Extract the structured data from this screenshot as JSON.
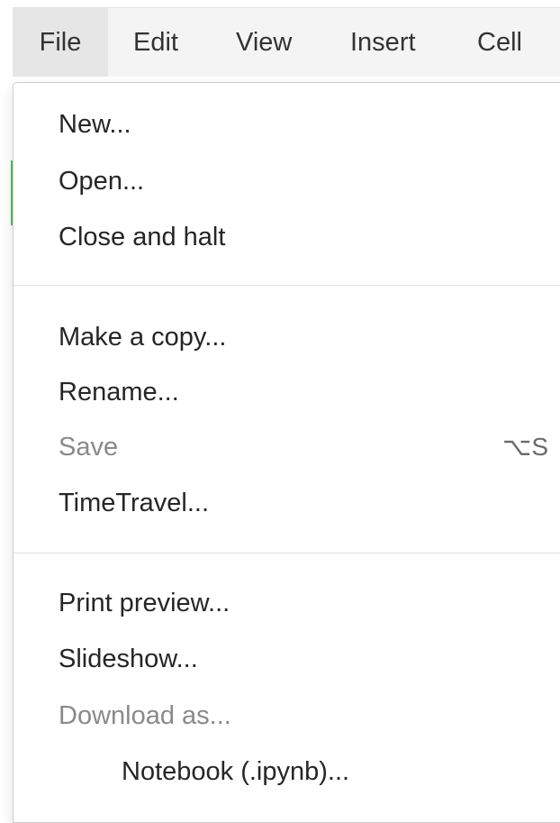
{
  "menubar": {
    "tabs": [
      "File",
      "Edit",
      "View",
      "Insert",
      "Cell"
    ],
    "active": "File"
  },
  "file_menu": {
    "group1": [
      "New...",
      "Open...",
      "Close and halt"
    ],
    "group2": [
      "Make a copy...",
      "Rename...",
      "Save",
      "TimeTravel..."
    ],
    "save_shortcut": "⌥S",
    "group3": [
      "Print preview...",
      "Slideshow...",
      "Download as..."
    ],
    "submenu_item": "Notebook (.ipynb)..."
  },
  "colors": {
    "menubar_bg": "#f4f4f4",
    "active_tab_bg": "#e6e6e6",
    "text": "#262626",
    "disabled_text": "#8a8a8a",
    "cell_marker": "#5cb85c"
  }
}
